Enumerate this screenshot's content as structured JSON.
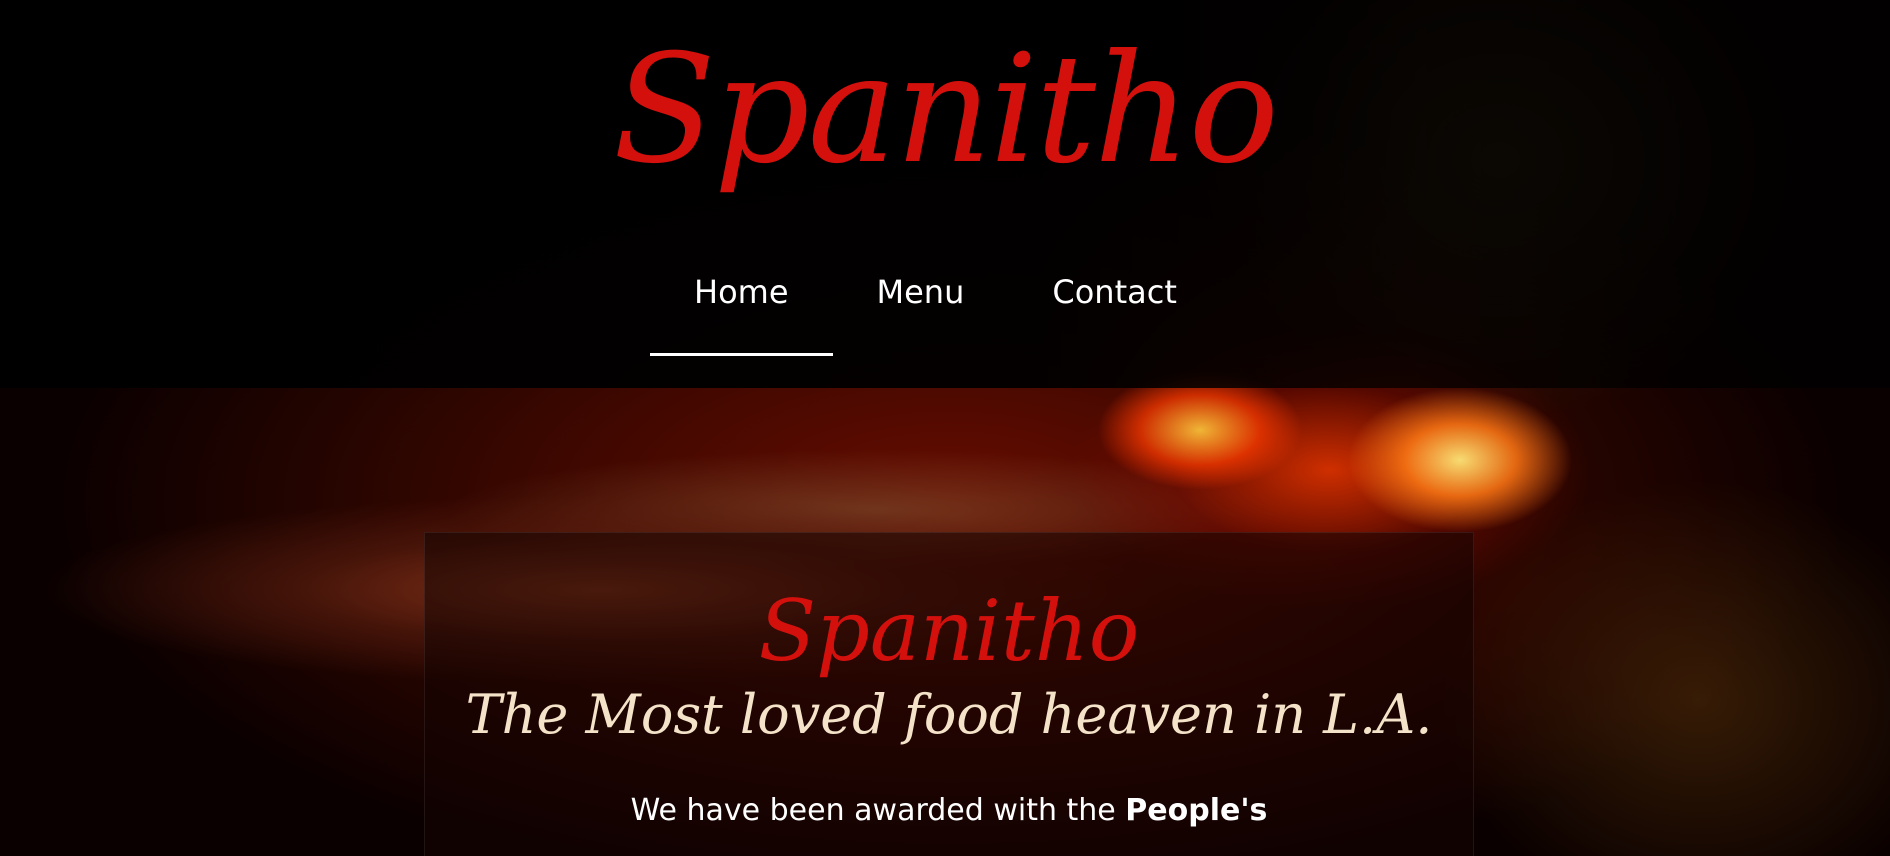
{
  "header": {
    "logo_text": "Spanitho",
    "nav": [
      {
        "label": "Home",
        "active": true
      },
      {
        "label": "Menu",
        "active": false
      },
      {
        "label": "Contact",
        "active": false
      }
    ]
  },
  "hero": {
    "title": "Spanitho",
    "subtitle": "The Most loved food heaven in L.A.",
    "text_lead": "We have been awarded with the ",
    "text_bold": "People's"
  },
  "colors": {
    "brand_red": "#d4100d",
    "subtitle_cream": "#f4e3c8",
    "nav_text": "#ffffff"
  }
}
